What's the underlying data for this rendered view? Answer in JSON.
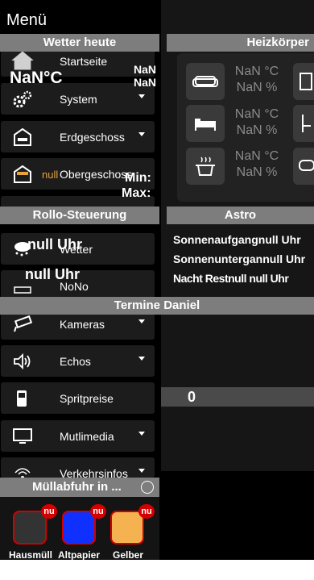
{
  "menu": {
    "title": "Menü",
    "items": [
      {
        "label": "Startseite"
      },
      {
        "label": "System"
      },
      {
        "label": "Erdgeschoss"
      },
      {
        "label": "Obergeschoss",
        "prefix": "null"
      },
      {
        "label": "Wetter"
      },
      {
        "label": "NoNo"
      },
      {
        "label": "Kameras"
      },
      {
        "label": "Echos"
      },
      {
        "label": "Spritpreise"
      },
      {
        "label": "Mutlimedia"
      },
      {
        "label": "Verkehrsinfos"
      }
    ]
  },
  "wetter": {
    "title": "Wetter heute",
    "temp": "NaN°C",
    "nan1": "NaN",
    "nan2": "NaN",
    "min": "Min:",
    "max": "Max:"
  },
  "heizkoerper": {
    "title": "Heizkörper",
    "rows": [
      {
        "temp": "NaN °C",
        "hum": "NaN %"
      },
      {
        "temp": "NaN °C",
        "hum": "NaN %"
      },
      {
        "temp": "NaN °C",
        "hum": "NaN %"
      }
    ]
  },
  "rollo": {
    "title": "Rollo-Steuerung",
    "time1": "null Uhr",
    "time2": "null Uhr"
  },
  "astro": {
    "title": "Astro",
    "sunrise": "Sonnenaufgangnull Uhr",
    "sunset": "Sonnenuntergannull Uhr",
    "garbled": "Nacht Restnull null Uhr"
  },
  "termine": {
    "title": "Termine Daniel",
    "count": "0"
  },
  "muell": {
    "title": "Müllabfuhr in ...",
    "bins": [
      {
        "label": "Hausmüll",
        "badge": "nu",
        "color": "#333333"
      },
      {
        "label": "Altpapier",
        "badge": "nu",
        "color": "#1030ff"
      },
      {
        "label": "Gelber",
        "badge": "nu",
        "color": "#f4b350"
      }
    ]
  }
}
